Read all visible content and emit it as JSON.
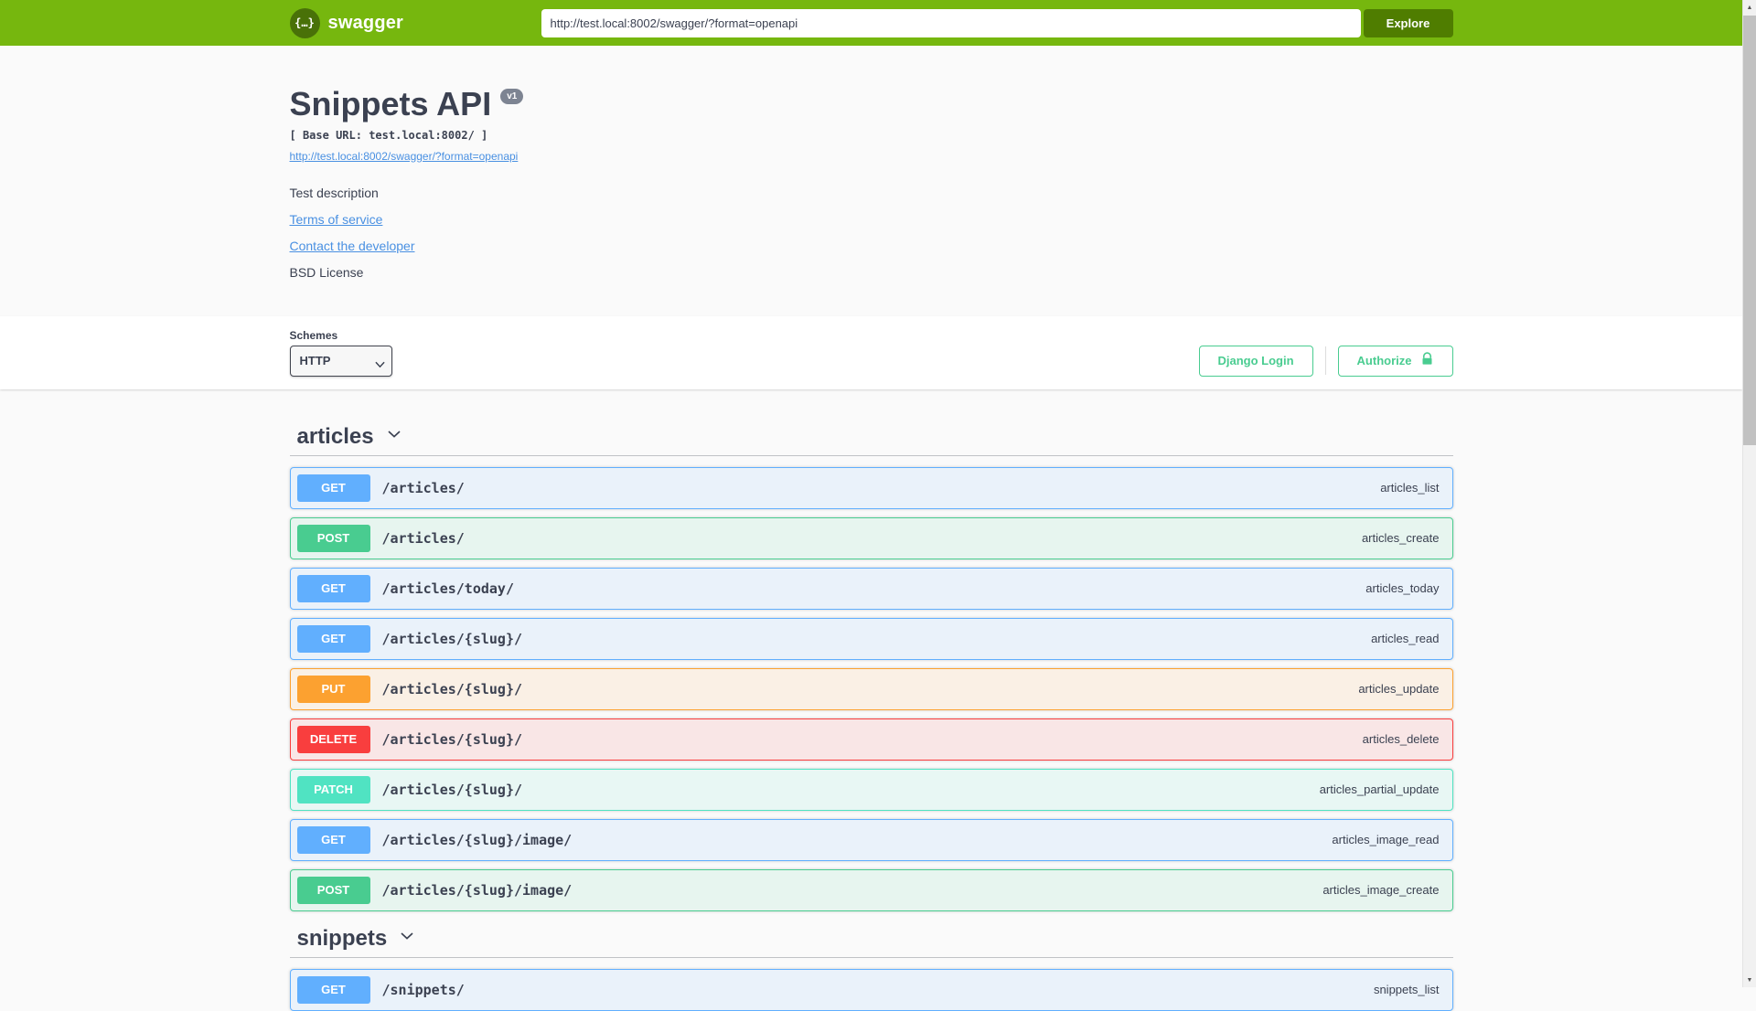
{
  "topbar": {
    "logo_glyph": "{…}",
    "brand": "swagger",
    "url_value": "http://test.local:8002/swagger/?format=openapi",
    "explore_label": "Explore"
  },
  "info": {
    "title": "Snippets API",
    "version_badge": "v1",
    "base_url_line": "[ Base URL: test.local:8002/ ]",
    "spec_link": "http://test.local:8002/swagger/?format=openapi",
    "description": "Test description",
    "terms_link": "Terms of service",
    "contact_link": "Contact the developer",
    "license": "BSD License"
  },
  "schemes": {
    "label": "Schemes",
    "selected": "HTTP"
  },
  "auth": {
    "django_login_label": "Django Login",
    "authorize_label": "Authorize"
  },
  "sections": [
    {
      "tag": "articles",
      "operations": [
        {
          "method": "GET",
          "path": "/articles/",
          "op_id": "articles_list"
        },
        {
          "method": "POST",
          "path": "/articles/",
          "op_id": "articles_create"
        },
        {
          "method": "GET",
          "path": "/articles/today/",
          "op_id": "articles_today"
        },
        {
          "method": "GET",
          "path": "/articles/{slug}/",
          "op_id": "articles_read"
        },
        {
          "method": "PUT",
          "path": "/articles/{slug}/",
          "op_id": "articles_update"
        },
        {
          "method": "DELETE",
          "path": "/articles/{slug}/",
          "op_id": "articles_delete"
        },
        {
          "method": "PATCH",
          "path": "/articles/{slug}/",
          "op_id": "articles_partial_update"
        },
        {
          "method": "GET",
          "path": "/articles/{slug}/image/",
          "op_id": "articles_image_read"
        },
        {
          "method": "POST",
          "path": "/articles/{slug}/image/",
          "op_id": "articles_image_create"
        }
      ]
    },
    {
      "tag": "snippets",
      "operations": [
        {
          "method": "GET",
          "path": "/snippets/",
          "op_id": "snippets_list"
        }
      ]
    }
  ],
  "colors": {
    "topbar_green": "#76b70e",
    "explore_green": "#4f7d00",
    "get_blue": "#61affe",
    "post_green": "#49cc90",
    "put_orange": "#fca130",
    "delete_red": "#f93e3e",
    "patch_teal": "#50e3c2",
    "authorize_green": "#49cc90",
    "link_blue": "#4990e2",
    "text_dark": "#3b4151"
  }
}
